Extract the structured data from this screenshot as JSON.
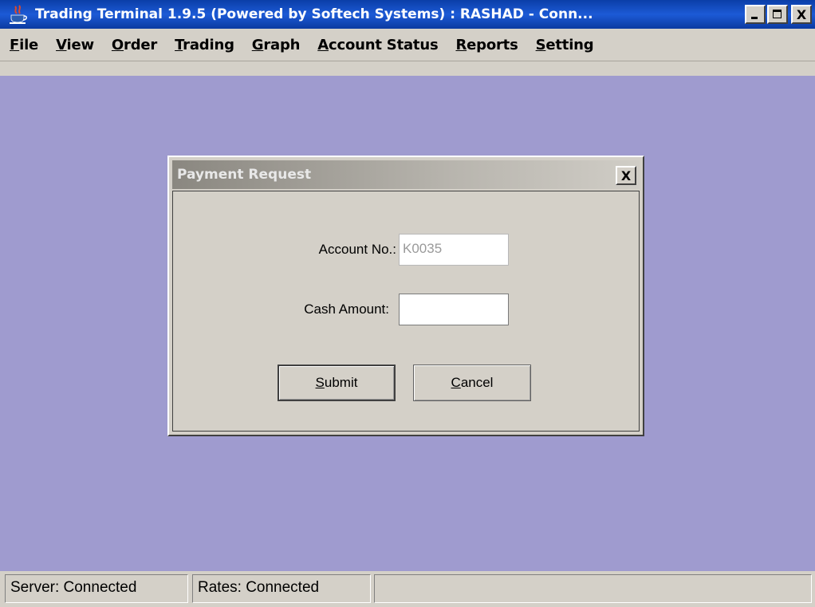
{
  "window": {
    "title": "Trading Terminal 1.9.5 (Powered by Softech Systems)   :   RASHAD - Conn...",
    "minimize": "_",
    "maximize": "□",
    "close": "X"
  },
  "menu": [
    {
      "first": "F",
      "rest": "ile"
    },
    {
      "first": "V",
      "rest": "iew"
    },
    {
      "first": "O",
      "rest": "rder"
    },
    {
      "first": "T",
      "rest": "rading"
    },
    {
      "first": "G",
      "rest": "raph"
    },
    {
      "first": "A",
      "rest": "ccount Status"
    },
    {
      "first": "R",
      "rest": "eports"
    },
    {
      "first": "S",
      "rest": "etting"
    }
  ],
  "dialog": {
    "title": "Payment Request",
    "close": "X",
    "account_label": "Account No.:",
    "account_value": "K0035",
    "cash_label": "Cash Amount:",
    "cash_value": "",
    "submit_first": "S",
    "submit_rest": "ubmit",
    "cancel_first": "C",
    "cancel_rest": "ancel"
  },
  "status": {
    "server": "Server: Connected",
    "rates": "Rates: Connected",
    "third": ""
  },
  "colors": {
    "desktop": "#9f9bcf",
    "titlebar": "#1c5ad6",
    "chrome": "#d4d0c8"
  },
  "icons": {
    "app": "java-cup-icon"
  }
}
